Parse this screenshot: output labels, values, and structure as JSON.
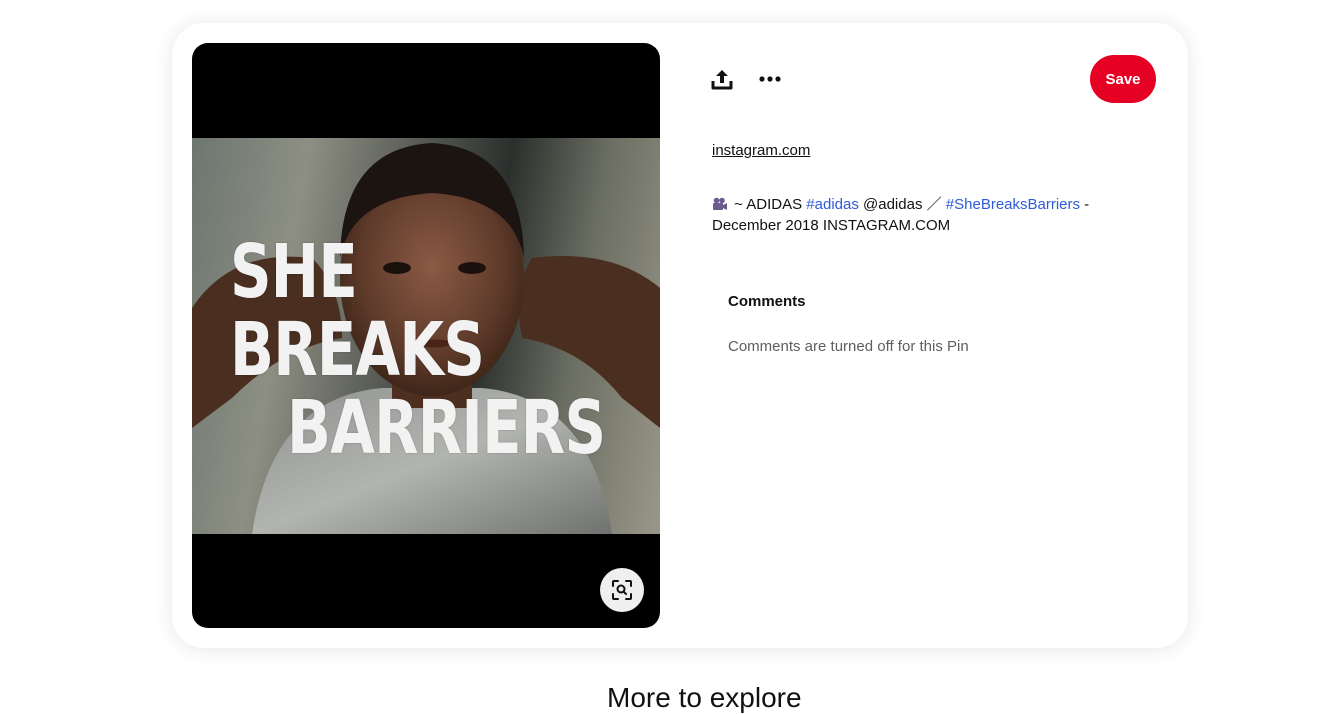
{
  "pin": {
    "media": {
      "overlay_lines": [
        "SHE",
        "BREAKS",
        "BARRIERS"
      ],
      "lens_icon": "visual-search-icon"
    },
    "actions": {
      "share_icon": "share-upload-icon",
      "more_icon": "more-ellipsis-icon",
      "save_label": "Save"
    },
    "source_link": "instagram.com",
    "description": {
      "camera_icon": "movie-camera-icon",
      "part1": " ~ ADIDAS ",
      "hashtag1": "#adidas",
      "part2": " @adidas ／ ",
      "hashtag2": "#SheBreaksBarriers",
      "part3": " - December 2018 INSTAGRAM.COM"
    },
    "comments": {
      "heading": "Comments",
      "status": "Comments are turned off for this Pin"
    }
  },
  "below": {
    "heading": "More to explore"
  },
  "colors": {
    "save_button": "#e60023",
    "hashtag": "#2e5bd9",
    "muted_text": "#5f5f5f"
  }
}
